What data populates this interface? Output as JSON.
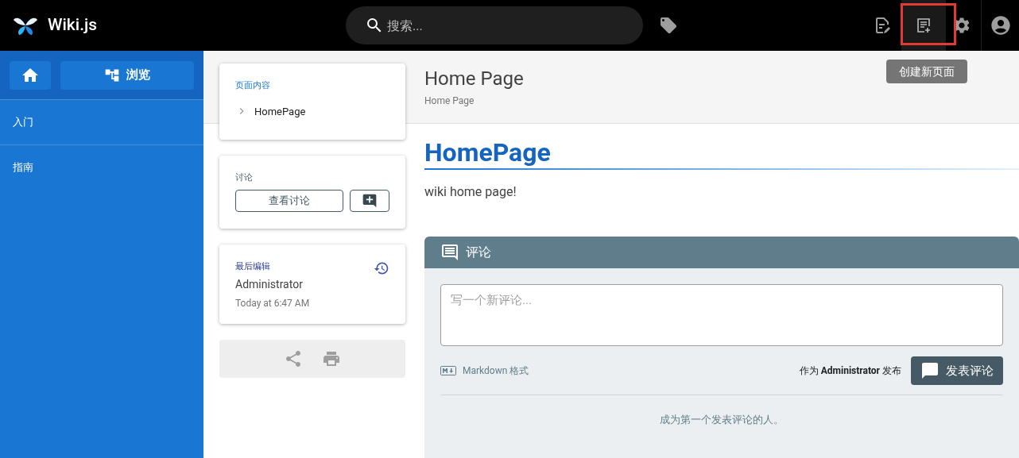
{
  "header": {
    "title": "Wiki.js",
    "search": {
      "placeholder": "搜索..."
    },
    "tooltip": "创建新页面",
    "new_page_highlighted": true
  },
  "sidebar": {
    "browse_label": "浏览",
    "items": [
      {
        "label": "入门"
      },
      {
        "label": "指南"
      }
    ]
  },
  "toc": {
    "title": "页面内容",
    "items": [
      {
        "label": "HomePage"
      }
    ]
  },
  "discussion": {
    "title": "讨论",
    "view_button": "查看讨论"
  },
  "last_edit": {
    "title": "最后编辑",
    "author": "Administrator",
    "time": "Today at 6:47 AM"
  },
  "page": {
    "title": "Home Page",
    "breadcrumb": "Home Page",
    "heading": "HomePage",
    "body": "wiki home page!"
  },
  "comments": {
    "title": "评论",
    "placeholder": "写一个新评论...",
    "format": "Markdown 格式",
    "post_as": "作为 **Administrator** 发布",
    "submit": "发表评论",
    "empty": "成为第一个发表评论的人。"
  }
}
